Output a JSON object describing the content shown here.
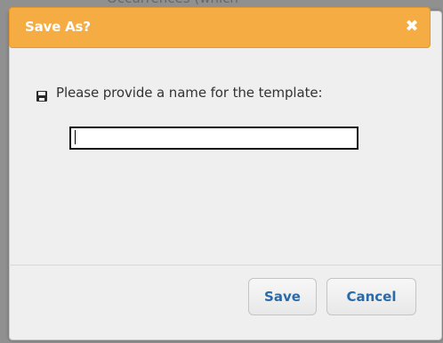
{
  "background": {
    "peek_text": "Occurrences (which"
  },
  "dialog": {
    "title": "Save As?",
    "close_glyph": "✖",
    "prompt": "Please provide a name for the template:",
    "input_value": "",
    "input_placeholder": "",
    "buttons": {
      "save": "Save",
      "cancel": "Cancel"
    },
    "icon": "save-disk-icon",
    "colors": {
      "titlebar": "#f5ac43",
      "button_text": "#2a6aa8",
      "dialog_bg": "#efefef"
    }
  }
}
